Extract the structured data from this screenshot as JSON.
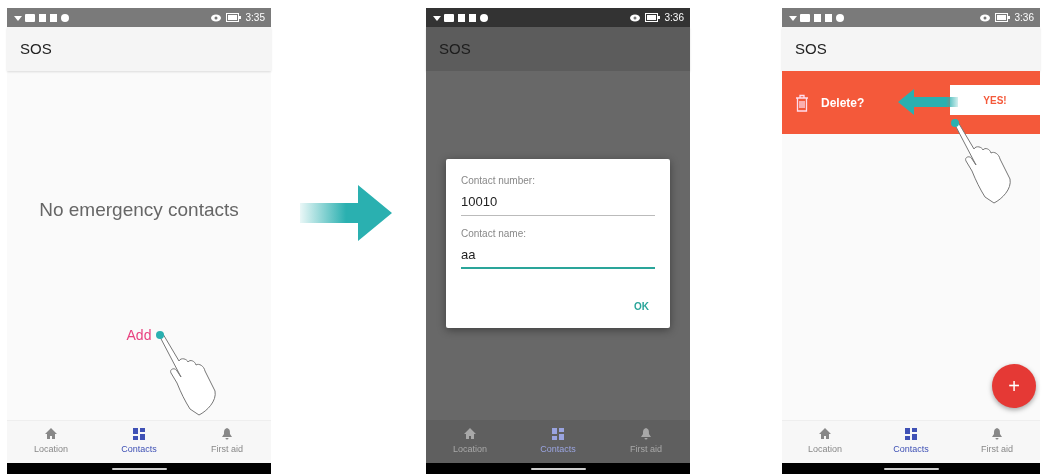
{
  "screens": [
    {
      "kind": "empty",
      "dimmed": false,
      "status_time": "3:35",
      "title": "SOS",
      "message": "No emergency contacts",
      "action": "Add",
      "nav": [
        {
          "label": "Location",
          "selected": false
        },
        {
          "label": "Contacts",
          "selected": true
        },
        {
          "label": "First aid",
          "selected": false
        }
      ]
    },
    {
      "kind": "dialog",
      "dimmed": true,
      "status_time": "3:36",
      "title": "SOS",
      "dialog": {
        "fields": [
          {
            "label": "Contact number:",
            "value": "10010",
            "focused": false
          },
          {
            "label": "Contact name:",
            "value": "aa",
            "focused": true
          }
        ],
        "button": "OK"
      },
      "nav": [
        {
          "label": "Location",
          "selected": false
        },
        {
          "label": "Contacts",
          "selected": true
        },
        {
          "label": "First aid",
          "selected": false
        }
      ]
    },
    {
      "kind": "swipe",
      "dimmed": false,
      "status_time": "3:36",
      "title": "SOS",
      "row": {
        "prompt": "Delete?",
        "confirm": "YES!"
      },
      "fab": "+",
      "nav": [
        {
          "label": "Location",
          "selected": false
        },
        {
          "label": "Contacts",
          "selected": true
        },
        {
          "label": "First aid",
          "selected": false
        }
      ]
    }
  ]
}
